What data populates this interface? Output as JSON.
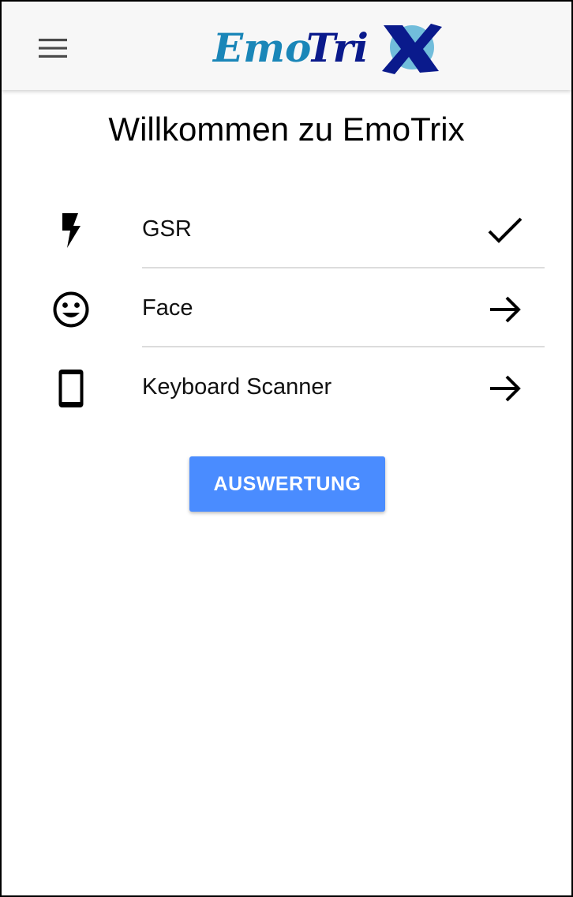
{
  "app": {
    "logo_text": "EmoTrix",
    "brand_colors": {
      "emo": "#1a86b8",
      "trix": "#0a1a8c",
      "x_accent": "#59b3d6"
    }
  },
  "header": {
    "menu_icon": "hamburger-menu-icon"
  },
  "main": {
    "title": "Willkommen zu EmoTrix",
    "items": [
      {
        "label": "GSR",
        "icon": "lightning-bolt-icon",
        "status_icon": "checkmark-icon"
      },
      {
        "label": "Face",
        "icon": "smiley-face-icon",
        "status_icon": "arrow-right-icon"
      },
      {
        "label": "Keyboard Scanner",
        "icon": "smartphone-icon",
        "status_icon": "arrow-right-icon"
      }
    ],
    "button_label": "AUSWERTUNG",
    "button_color": "#4a8cff"
  }
}
